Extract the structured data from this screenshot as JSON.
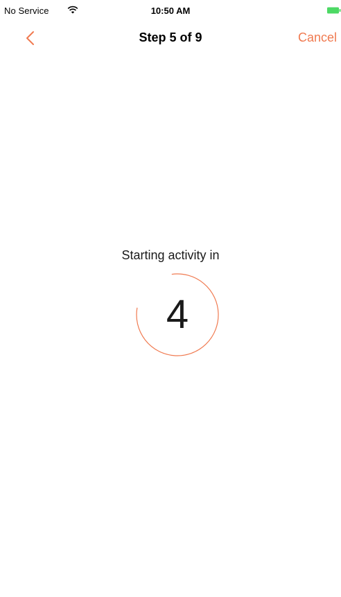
{
  "status_bar": {
    "carrier": "No Service",
    "time": "10:50 AM",
    "wifi_icon": "wifi-icon",
    "battery_icon": "battery-icon",
    "battery_color": "#4cd964"
  },
  "nav": {
    "back_icon": "chevron-left-icon",
    "title": "Step 5 of 9",
    "cancel_label": "Cancel",
    "accent_color": "#f07a50"
  },
  "countdown": {
    "label": "Starting activity in",
    "value": "4",
    "ring_color": "#f07a50",
    "remaining_fraction": 0.8
  }
}
